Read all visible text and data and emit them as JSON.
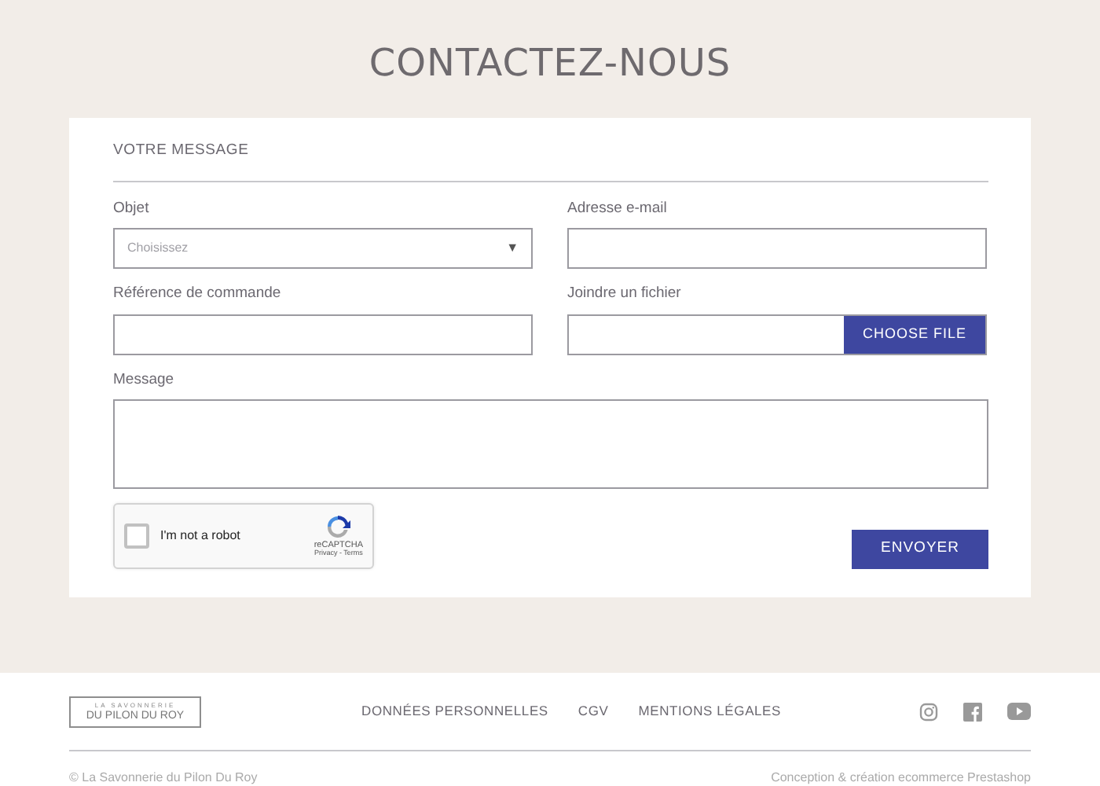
{
  "page_title": "CONTACTEZ-NOUS",
  "form": {
    "section_title": "VOTRE MESSAGE",
    "fields": [
      {
        "kind": "select",
        "label": "Objet",
        "placeholder": "Choisissez",
        "caret": "▼"
      },
      {
        "kind": "text",
        "label": "Adresse e-mail"
      },
      {
        "kind": "text",
        "label": "Référence de commande"
      },
      {
        "kind": "file",
        "label": "Joindre un fichier",
        "button": "CHOOSE FILE"
      },
      {
        "kind": "textarea",
        "label": "Message"
      }
    ],
    "captcha": {
      "label": "I'm not a robot",
      "checked": false,
      "brand": "reCAPTCHA",
      "links": "Privacy - Terms"
    },
    "submit": "ENVOYER"
  },
  "footer": {
    "logo_top": "LA SAVONNERIE",
    "logo_bottom": "DU PILON DU ROY",
    "links": [
      "DONNÉES PERSONNELLES",
      "CGV",
      "MENTIONS LÉGALES"
    ],
    "copyright": "© La Savonnerie du Pilon Du Roy",
    "credit": "Conception & création ecommerce Prestashop"
  }
}
